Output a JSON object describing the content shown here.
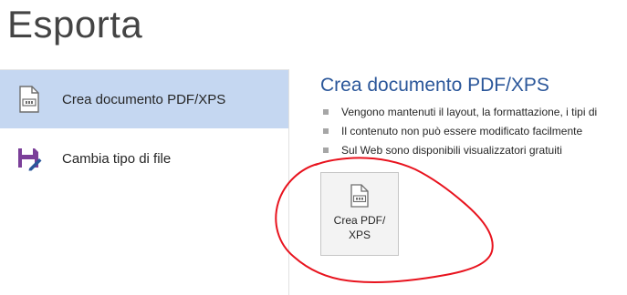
{
  "page": {
    "title": "Esporta"
  },
  "sidebar": {
    "items": [
      {
        "label": "Crea documento PDF/XPS",
        "icon": "pdf-document-icon",
        "selected": true
      },
      {
        "label": "Cambia tipo di file",
        "icon": "save-as-icon",
        "selected": false
      }
    ]
  },
  "main": {
    "section_title": "Crea documento PDF/XPS",
    "bullets": [
      "Vengono mantenuti il layout, la formattazione, i tipi di",
      "Il contenuto non può essere modificato facilmente",
      "Sul Web sono disponibili visualizzatori gratuiti"
    ],
    "create_button": {
      "line1": "Crea PDF/",
      "line2": "XPS",
      "icon": "pdf-document-icon"
    }
  },
  "colors": {
    "selected_background": "#c5d7f1",
    "section_title": "#2b579a",
    "annotation": "#e8131e",
    "save_icon": "#7b3f99"
  }
}
